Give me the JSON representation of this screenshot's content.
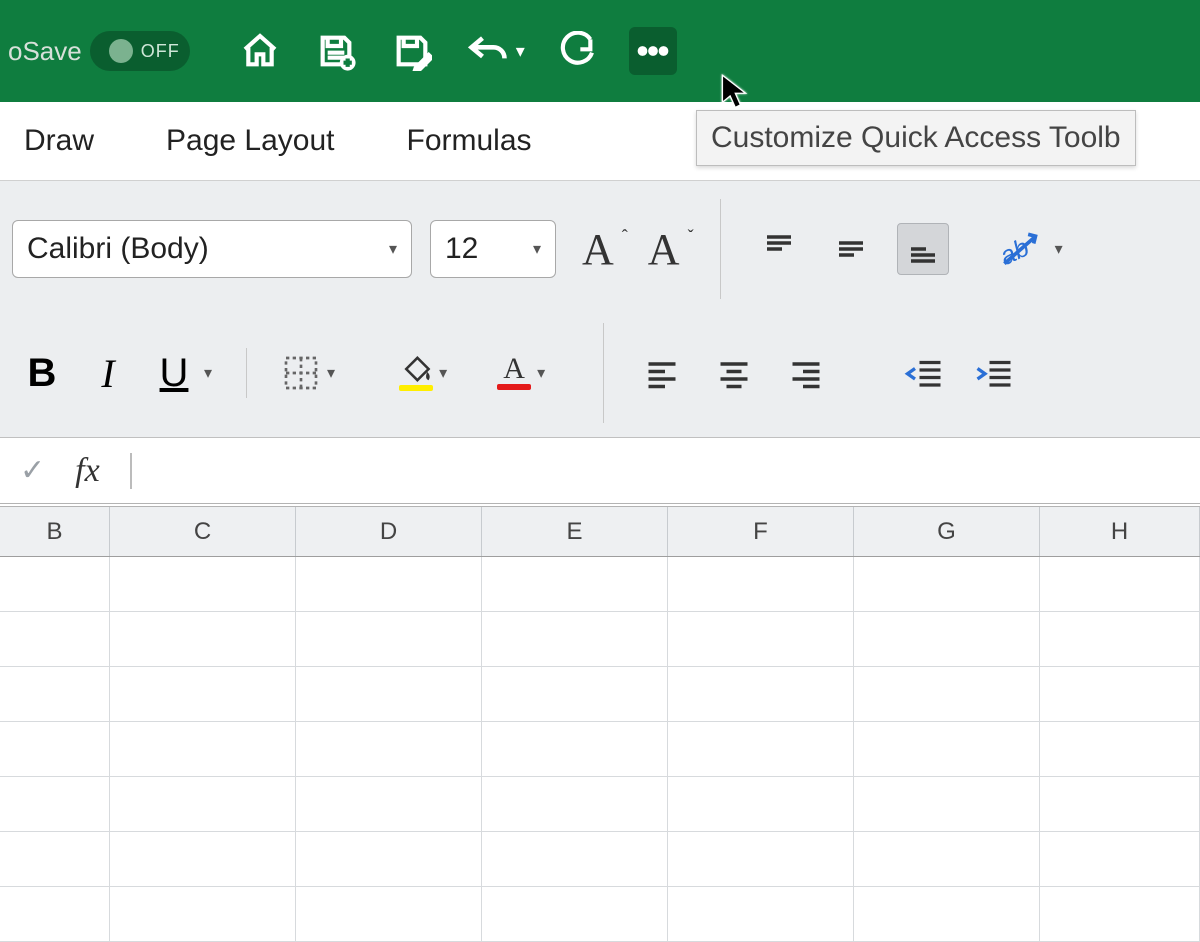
{
  "titlebar": {
    "autosave_label": "oSave",
    "toggle_text": "OFF"
  },
  "tabs": {
    "draw": "Draw",
    "page_layout": "Page Layout",
    "formulas": "Formulas"
  },
  "tooltip": {
    "customize_qat": "Customize Quick Access Toolb"
  },
  "ribbon": {
    "font_name": "Calibri (Body)",
    "font_size": "12",
    "increase_font": "A",
    "decrease_font": "A",
    "bold": "B",
    "italic": "I",
    "underline": "U",
    "font_color_letter": "A",
    "fill_swatch": "#ffee00",
    "font_swatch": "#e41a1a"
  },
  "formula_bar": {
    "fx": "fx"
  },
  "columns": [
    "B",
    "C",
    "D",
    "E",
    "F",
    "G",
    "H"
  ],
  "grid": {
    "rows": 7
  }
}
